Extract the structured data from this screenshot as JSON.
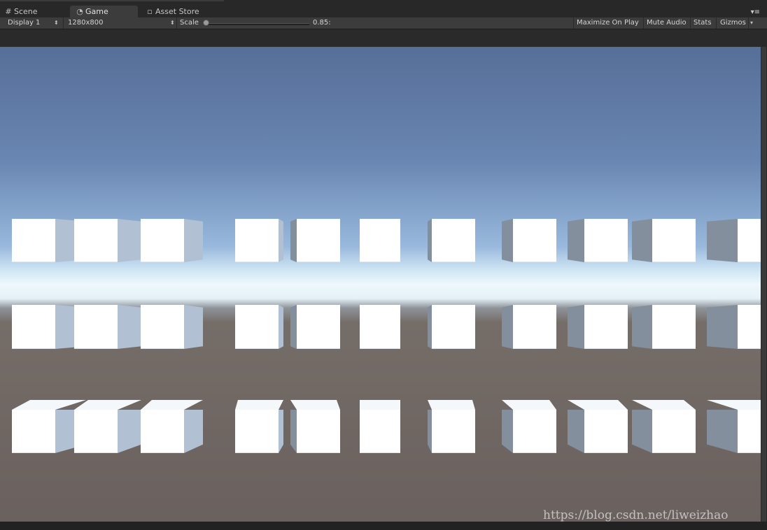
{
  "tabs": [
    {
      "label": "Scene",
      "icon": "grid-icon"
    },
    {
      "label": "Game",
      "icon": "pacman-icon"
    },
    {
      "label": "Asset Store",
      "icon": "bag-icon"
    }
  ],
  "toolbar": {
    "display": "Display 1",
    "resolution": "1280x800",
    "scale_label": "Scale",
    "scale_value": "0.85:",
    "scale_fraction": 0.0,
    "maximize": "Maximize On Play",
    "mute": "Mute Audio",
    "stats": "Stats",
    "gizmos": "Gizmos"
  },
  "watermark": "https://blog.csdn.net/liweizhao",
  "scene": {
    "sky_color": "#6a87b3",
    "ground_color": "#6b625f",
    "horizon_color": "#eef8fc",
    "cube_color": "#ffffff",
    "cube_side_color": "#a9b7c9"
  }
}
